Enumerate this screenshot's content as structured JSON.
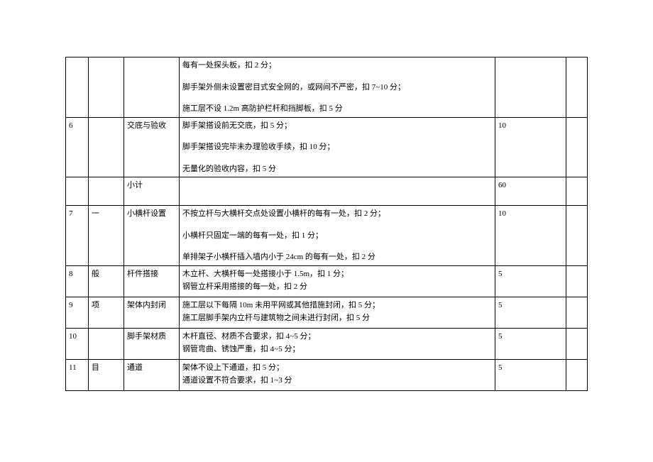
{
  "rows": [
    {
      "num": "",
      "cat": "",
      "item": "",
      "desc": [
        "每有一处探头板，扣 2 分；",
        "脚手架外侧未设置密目式安全网的，或网间不严密，扣 7~10 分；",
        "施工层不设 1.2m 高防护栏杆和挡脚板，扣 5 分"
      ],
      "score": "",
      "last": "",
      "tight": false
    },
    {
      "num": "6",
      "cat": "",
      "item": "交底与验收",
      "desc": [
        "脚手架搭设前无交底，扣 5 分；",
        "脚手架搭设完毕未办理验收手续，扣 10 分；",
        "无量化的验收内容，扣 5 分"
      ],
      "score": "10",
      "last": "",
      "tight": false
    },
    {
      "num": "",
      "cat": "",
      "item": "小计",
      "desc": [
        ""
      ],
      "score": "60",
      "last": "",
      "subtotal": true
    },
    {
      "num": "7",
      "cat": "一",
      "item": "小横杆设置",
      "desc": [
        "不按立杆与大横杆交点处设置小横杆的每有一处，扣 2 分；",
        "小横杆只固定一端的每有一处，扣 1 分；",
        "单排架子小横杆插入墙内小于 24cm 的每有一处，扣 2 分"
      ],
      "score": "10",
      "last": "",
      "tight": false
    },
    {
      "num": "8",
      "cat": "般",
      "item": "杆件搭接",
      "desc": [
        "木立杆、大横杆每一处搭接小于 1.5m，扣 1 分；",
        "钢管立杆采用搭接的每一处，扣 2 分"
      ],
      "score": "5",
      "last": "",
      "tight": true
    },
    {
      "num": "9",
      "cat": "项",
      "item": "架体内封闭",
      "desc": [
        "施工层以下每隔 10m 未用平网或其他措施封闭，扣 5 分；",
        "施工层脚手架内立杆与建筑物之间未进行封闭，扣 5 分"
      ],
      "score": "5",
      "last": "",
      "tight": true
    },
    {
      "num": "10",
      "cat": "",
      "item": "脚手架材质",
      "desc": [
        "木杆直径、材质不合要求，扣 4~5 分；",
        "钢管弯曲、锈蚀严重，扣 4~5 分；"
      ],
      "score": "5",
      "last": "",
      "tight": true
    },
    {
      "num": "11",
      "cat": "目",
      "item": "通道",
      "desc": [
        "架体不设上下通道，扣 5 分；",
        "通道设置不符合要求，扣 1~3 分"
      ],
      "score": "5",
      "last": "",
      "tight": true
    }
  ]
}
